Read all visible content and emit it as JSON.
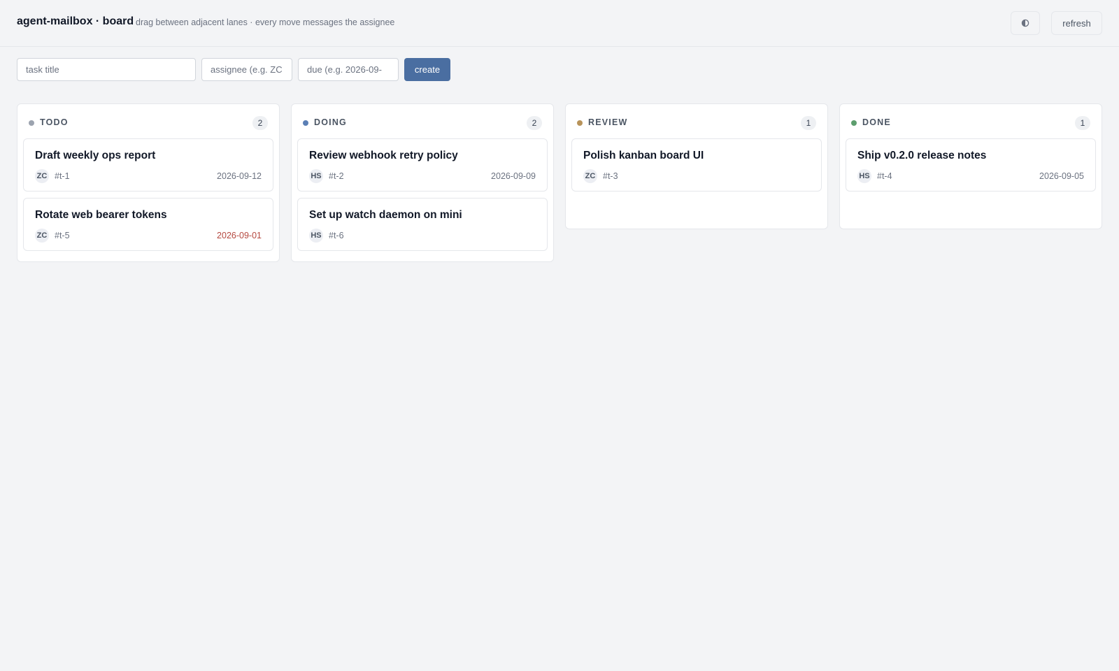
{
  "header": {
    "title": "agent-mailbox · board",
    "subtitle": "drag between adjacent lanes · every move messages the assignee",
    "theme_icon": "half-circle-contrast-icon",
    "refresh_label": "refresh"
  },
  "form": {
    "title_placeholder": "task title",
    "title_value": "",
    "assignee_placeholder": "assignee (e.g. ZC",
    "assignee_value": "",
    "due_placeholder": "due (e.g. 2026-09-",
    "due_value": "",
    "create_label": "create"
  },
  "colors": {
    "accent": "#4a6ea1",
    "todo": "#9ca3af",
    "doing": "#5b7fb5",
    "review": "#b8935a",
    "done": "#5d9e6e",
    "overdue": "#b5483f"
  },
  "lanes": [
    {
      "name": "TODO",
      "count": "2",
      "cards": [
        {
          "title": "Draft weekly ops report",
          "assignee": "ZC",
          "id": "#t-1",
          "due": "2026-09-12",
          "overdue": false
        },
        {
          "title": "Rotate web bearer tokens",
          "assignee": "ZC",
          "id": "#t-5",
          "due": "2026-09-01",
          "overdue": true
        }
      ]
    },
    {
      "name": "DOING",
      "count": "2",
      "cards": [
        {
          "title": "Review webhook retry policy",
          "assignee": "HS",
          "id": "#t-2",
          "due": "2026-09-09",
          "overdue": false
        },
        {
          "title": "Set up watch daemon on mini",
          "assignee": "HS",
          "id": "#t-6",
          "due": "",
          "overdue": false
        }
      ]
    },
    {
      "name": "REVIEW",
      "count": "1",
      "cards": [
        {
          "title": "Polish kanban board UI",
          "assignee": "ZC",
          "id": "#t-3",
          "due": "",
          "overdue": false
        }
      ]
    },
    {
      "name": "DONE",
      "count": "1",
      "cards": [
        {
          "title": "Ship v0.2.0 release notes",
          "assignee": "HS",
          "id": "#t-4",
          "due": "2026-09-05",
          "overdue": false
        }
      ]
    }
  ]
}
